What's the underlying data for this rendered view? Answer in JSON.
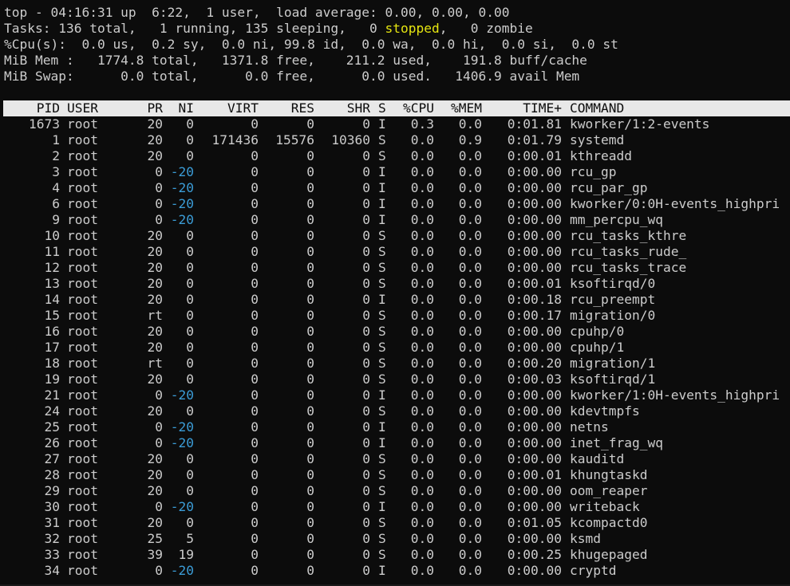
{
  "summary": {
    "line1": "top - 04:16:31 up  6:22,  1 user,  load average: 0.00, 0.00, 0.00",
    "line2_pre": "Tasks: 136 total,   1 running, 135 sleeping,   0 ",
    "line2_stopped": "stopped",
    "line2_post": ",   0 zombie",
    "line3": "%Cpu(s):  0.0 us,  0.2 sy,  0.0 ni, 99.8 id,  0.0 wa,  0.0 hi,  0.0 si,  0.0 st",
    "line4": "MiB Mem :   1774.8 total,   1371.8 free,    211.2 used,    191.8 buff/cache",
    "line5": "MiB Swap:      0.0 total,      0.0 free,      0.0 used.   1406.9 avail Mem"
  },
  "columns": [
    "PID",
    "USER",
    "PR",
    "NI",
    "VIRT",
    "RES",
    "SHR",
    "S",
    "%CPU",
    "%MEM",
    "TIME+",
    "COMMAND"
  ],
  "processes": [
    [
      "1673",
      "root",
      "20",
      "0",
      "0",
      "0",
      "0",
      "I",
      "0.3",
      "0.0",
      "0:01.81",
      "kworker/1:2-events"
    ],
    [
      "1",
      "root",
      "20",
      "0",
      "171436",
      "15576",
      "10360",
      "S",
      "0.0",
      "0.9",
      "0:01.79",
      "systemd"
    ],
    [
      "2",
      "root",
      "20",
      "0",
      "0",
      "0",
      "0",
      "S",
      "0.0",
      "0.0",
      "0:00.01",
      "kthreadd"
    ],
    [
      "3",
      "root",
      "0",
      "-20",
      "0",
      "0",
      "0",
      "I",
      "0.0",
      "0.0",
      "0:00.00",
      "rcu_gp"
    ],
    [
      "4",
      "root",
      "0",
      "-20",
      "0",
      "0",
      "0",
      "I",
      "0.0",
      "0.0",
      "0:00.00",
      "rcu_par_gp"
    ],
    [
      "6",
      "root",
      "0",
      "-20",
      "0",
      "0",
      "0",
      "I",
      "0.0",
      "0.0",
      "0:00.00",
      "kworker/0:0H-events_highpri"
    ],
    [
      "9",
      "root",
      "0",
      "-20",
      "0",
      "0",
      "0",
      "I",
      "0.0",
      "0.0",
      "0:00.00",
      "mm_percpu_wq"
    ],
    [
      "10",
      "root",
      "20",
      "0",
      "0",
      "0",
      "0",
      "S",
      "0.0",
      "0.0",
      "0:00.00",
      "rcu_tasks_kthre"
    ],
    [
      "11",
      "root",
      "20",
      "0",
      "0",
      "0",
      "0",
      "S",
      "0.0",
      "0.0",
      "0:00.00",
      "rcu_tasks_rude_"
    ],
    [
      "12",
      "root",
      "20",
      "0",
      "0",
      "0",
      "0",
      "S",
      "0.0",
      "0.0",
      "0:00.00",
      "rcu_tasks_trace"
    ],
    [
      "13",
      "root",
      "20",
      "0",
      "0",
      "0",
      "0",
      "S",
      "0.0",
      "0.0",
      "0:00.01",
      "ksoftirqd/0"
    ],
    [
      "14",
      "root",
      "20",
      "0",
      "0",
      "0",
      "0",
      "I",
      "0.0",
      "0.0",
      "0:00.18",
      "rcu_preempt"
    ],
    [
      "15",
      "root",
      "rt",
      "0",
      "0",
      "0",
      "0",
      "S",
      "0.0",
      "0.0",
      "0:00.17",
      "migration/0"
    ],
    [
      "16",
      "root",
      "20",
      "0",
      "0",
      "0",
      "0",
      "S",
      "0.0",
      "0.0",
      "0:00.00",
      "cpuhp/0"
    ],
    [
      "17",
      "root",
      "20",
      "0",
      "0",
      "0",
      "0",
      "S",
      "0.0",
      "0.0",
      "0:00.00",
      "cpuhp/1"
    ],
    [
      "18",
      "root",
      "rt",
      "0",
      "0",
      "0",
      "0",
      "S",
      "0.0",
      "0.0",
      "0:00.20",
      "migration/1"
    ],
    [
      "19",
      "root",
      "20",
      "0",
      "0",
      "0",
      "0",
      "S",
      "0.0",
      "0.0",
      "0:00.03",
      "ksoftirqd/1"
    ],
    [
      "21",
      "root",
      "0",
      "-20",
      "0",
      "0",
      "0",
      "I",
      "0.0",
      "0.0",
      "0:00.00",
      "kworker/1:0H-events_highpri"
    ],
    [
      "24",
      "root",
      "20",
      "0",
      "0",
      "0",
      "0",
      "S",
      "0.0",
      "0.0",
      "0:00.00",
      "kdevtmpfs"
    ],
    [
      "25",
      "root",
      "0",
      "-20",
      "0",
      "0",
      "0",
      "I",
      "0.0",
      "0.0",
      "0:00.00",
      "netns"
    ],
    [
      "26",
      "root",
      "0",
      "-20",
      "0",
      "0",
      "0",
      "I",
      "0.0",
      "0.0",
      "0:00.00",
      "inet_frag_wq"
    ],
    [
      "27",
      "root",
      "20",
      "0",
      "0",
      "0",
      "0",
      "S",
      "0.0",
      "0.0",
      "0:00.00",
      "kauditd"
    ],
    [
      "28",
      "root",
      "20",
      "0",
      "0",
      "0",
      "0",
      "S",
      "0.0",
      "0.0",
      "0:00.01",
      "khungtaskd"
    ],
    [
      "29",
      "root",
      "20",
      "0",
      "0",
      "0",
      "0",
      "S",
      "0.0",
      "0.0",
      "0:00.00",
      "oom_reaper"
    ],
    [
      "30",
      "root",
      "0",
      "-20",
      "0",
      "0",
      "0",
      "I",
      "0.0",
      "0.0",
      "0:00.00",
      "writeback"
    ],
    [
      "31",
      "root",
      "20",
      "0",
      "0",
      "0",
      "0",
      "S",
      "0.0",
      "0.0",
      "0:01.05",
      "kcompactd0"
    ],
    [
      "32",
      "root",
      "25",
      "5",
      "0",
      "0",
      "0",
      "S",
      "0.0",
      "0.0",
      "0:00.00",
      "ksmd"
    ],
    [
      "33",
      "root",
      "39",
      "19",
      "0",
      "0",
      "0",
      "S",
      "0.0",
      "0.0",
      "0:00.25",
      "khugepaged"
    ],
    [
      "34",
      "root",
      "0",
      "-20",
      "0",
      "0",
      "0",
      "I",
      "0.0",
      "0.0",
      "0:00.00",
      "cryptd"
    ]
  ],
  "colors": {
    "background": "#0c0c0c",
    "text": "#cccccc",
    "stopped": "#e5e510",
    "negative_nice": "#3b9cd6",
    "header_bar": "#e8e8e8"
  }
}
